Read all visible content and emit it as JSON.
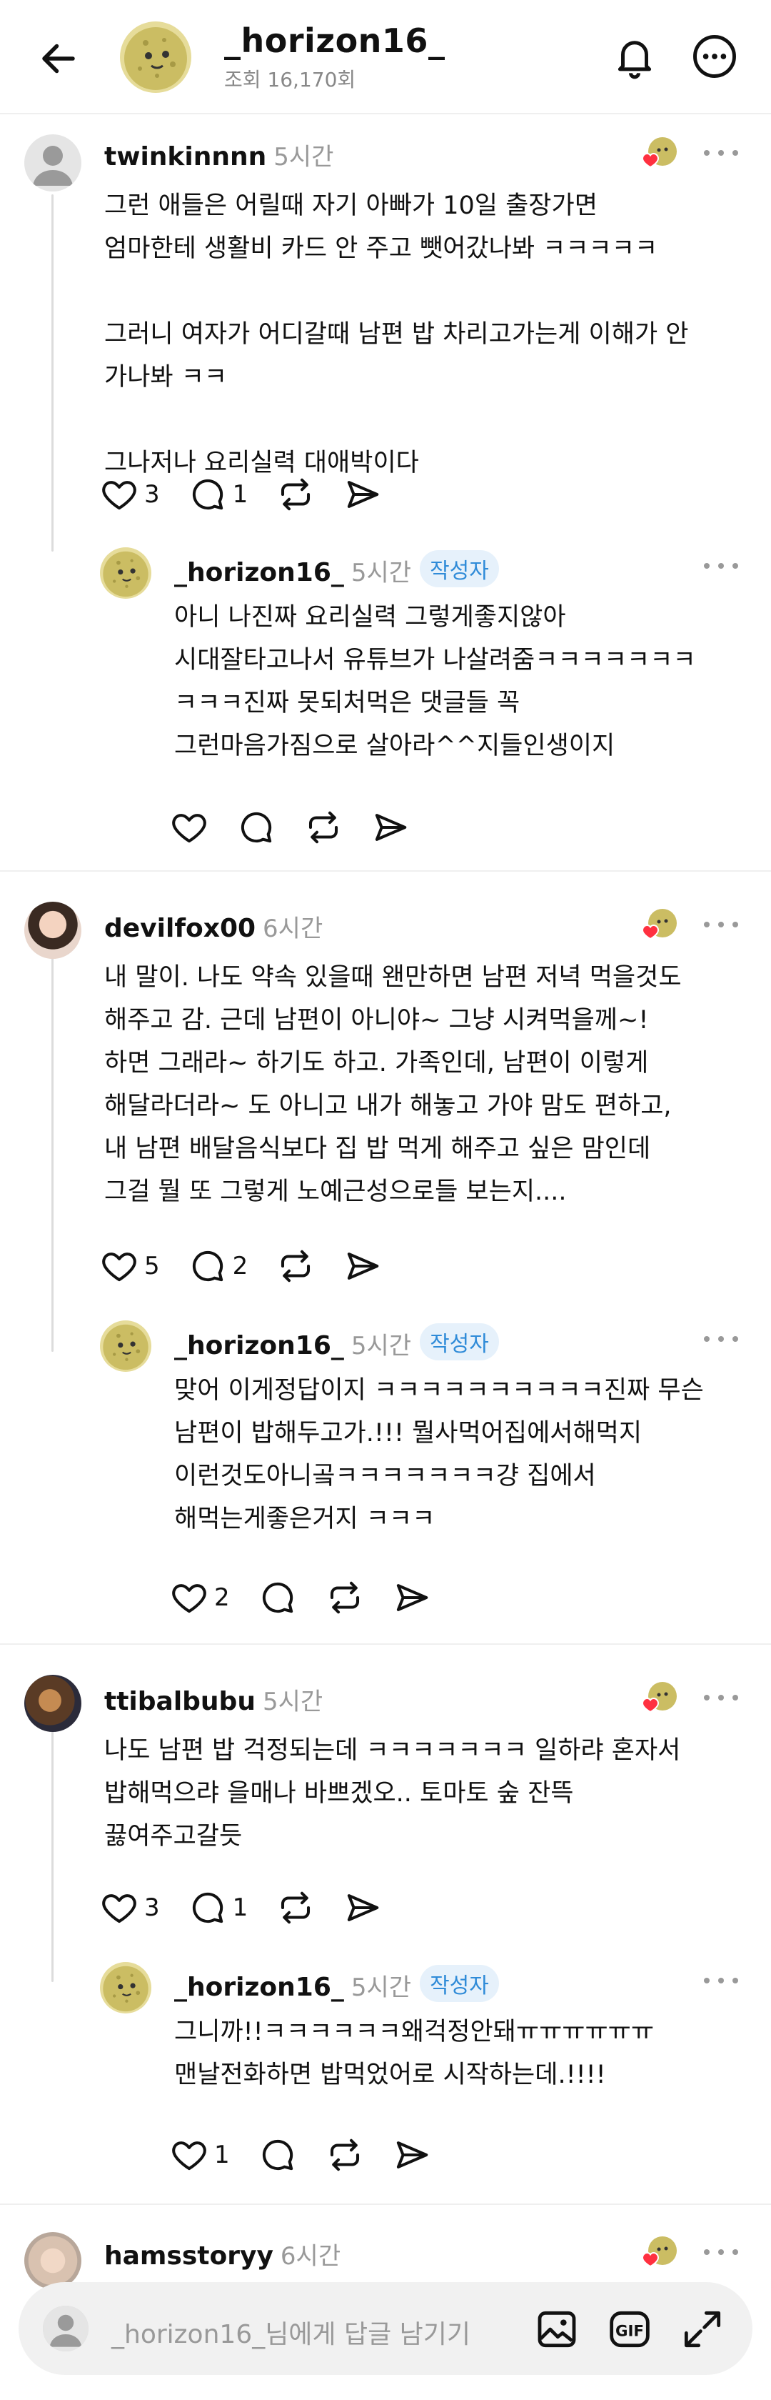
{
  "header": {
    "title": "_horizon16_",
    "views": "조회 16,170회"
  },
  "threads": [
    {
      "user": "twinkinnnn",
      "time": "5시간",
      "text": "그런 애들은 어릴때 자기 아빠가 10일 출장가면\n엄마한테 생활비 카드 안 주고 뺏어갔나봐 ㅋㅋㅋㅋㅋ\n\n그러니 여자가 어디갈때 남편 밥 차리고가는게 이해가 안\n가나봐 ㅋㅋ\n\n그나저나 요리실력 대애박이다",
      "likes": "3",
      "comments": "1",
      "reply": {
        "user": "_horizon16_",
        "time": "5시간",
        "badge": "작성자",
        "text": "아니 나진짜 요리실력 그렇게좋지않아\n시대잘타고나서 유튜브가 나살려줌ㅋㅋㅋㅋㅋㅋㅋ\nㅋㅋㅋ진짜 못되처먹은 댓글들 꼭\n그런마음가짐으로 살아라^^지들인생이지",
        "likes": ""
      }
    },
    {
      "user": "devilfox00",
      "time": "6시간",
      "text": "내 말이. 나도 약속 있을때 왠만하면 남편 저녁 먹을것도\n해주고 감. 근데 남편이 아니야~ 그냥 시켜먹을께~!\n하면 그래라~ 하기도 하고. 가족인데, 남편이 이렇게\n해달라더라~ 도 아니고 내가 해놓고 가야 맘도 편하고,\n내 남편 배달음식보다 집 밥 먹게 해주고 싶은 맘인데\n그걸 뭘 또 그렇게 노예근성으로들 보는지....",
      "likes": "5",
      "comments": "2",
      "reply": {
        "user": "_horizon16_",
        "time": "5시간",
        "badge": "작성자",
        "text": "맞어 이게정답이지 ㅋㅋㅋㅋㅋㅋㅋㅋㅋㅋ진짜 무슨\n남편이 밥해두고가.!!! 뭘사먹어집에서해먹지\n이런것도아니곸ㅋㅋㅋㅋㅋㅋㅋ걍 집에서\n해먹는게좋은거지 ㅋㅋㅋ",
        "likes": "2"
      }
    },
    {
      "user": "ttibalbubu",
      "time": "5시간",
      "text": "나도 남편 밥 걱정되는데 ㅋㅋㅋㅋㅋㅋㅋ 일하랴 혼자서\n밥해먹으랴 을매나 바쁘겠오.. 토마토 숲 잔뜩\n끓여주고갈듯",
      "likes": "3",
      "comments": "1",
      "reply": {
        "user": "_horizon16_",
        "time": "5시간",
        "badge": "작성자",
        "text": "그니까!!ㅋㅋㅋㅋㅋㅋ왜걱정안돼ㅠㅠㅠㅠㅠㅠ\n맨날전화하면 밥먹었어로 시작하는데.!!!!",
        "likes": "1"
      }
    },
    {
      "user": "hamsstoryy",
      "time": "6시간"
    }
  ],
  "compose": {
    "placeholder": "_horizon16_님에게 답글 남기기"
  },
  "icons": [
    "back-arrow-icon",
    "bell-icon",
    "more-icon",
    "heart-icon",
    "comment-icon",
    "repost-icon",
    "share-icon",
    "image-icon",
    "gif-icon",
    "expand-icon"
  ]
}
